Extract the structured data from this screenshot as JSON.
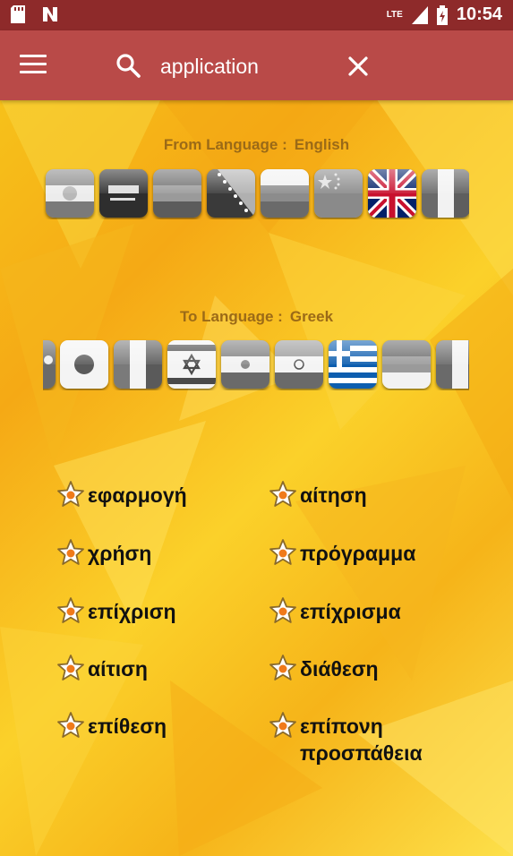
{
  "status_bar": {
    "time": "10:54",
    "network": "LTE"
  },
  "app_bar": {
    "search_value": "application"
  },
  "from_language": {
    "label": "From Language :",
    "value": "English"
  },
  "to_language": {
    "label": "To Language :",
    "value": "Greek"
  },
  "colors": {
    "status_bar": "#8e2a2a",
    "app_bar": "#b94a48",
    "label_text": "#9b6a17",
    "word_text": "#111111"
  },
  "from_flags": [
    "flag-kurdistan",
    "flag-saudi-arabia",
    "flag-gray-triband",
    "flag-bosnia",
    "flag-gray-horizontal",
    "flag-china",
    "flag-united-kingdom",
    "flag-gray-vertical"
  ],
  "to_flags": [
    "flag-partial-crescent",
    "flag-japan",
    "flag-gray-vertical",
    "flag-israel",
    "flag-iran",
    "flag-india",
    "flag-greece",
    "flag-gray-triband",
    "flag-gray-vertical-partial"
  ],
  "translations": [
    {
      "text": "εφαρμογή"
    },
    {
      "text": "αίτηση"
    },
    {
      "text": "χρήση"
    },
    {
      "text": "πρόγραμμα"
    },
    {
      "text": "επίχριση"
    },
    {
      "text": "επίχρισμα"
    },
    {
      "text": "αίτιση"
    },
    {
      "text": "διάθεση"
    },
    {
      "text": "επίθεση"
    },
    {
      "text": "επίπονη προσπάθεια"
    }
  ]
}
